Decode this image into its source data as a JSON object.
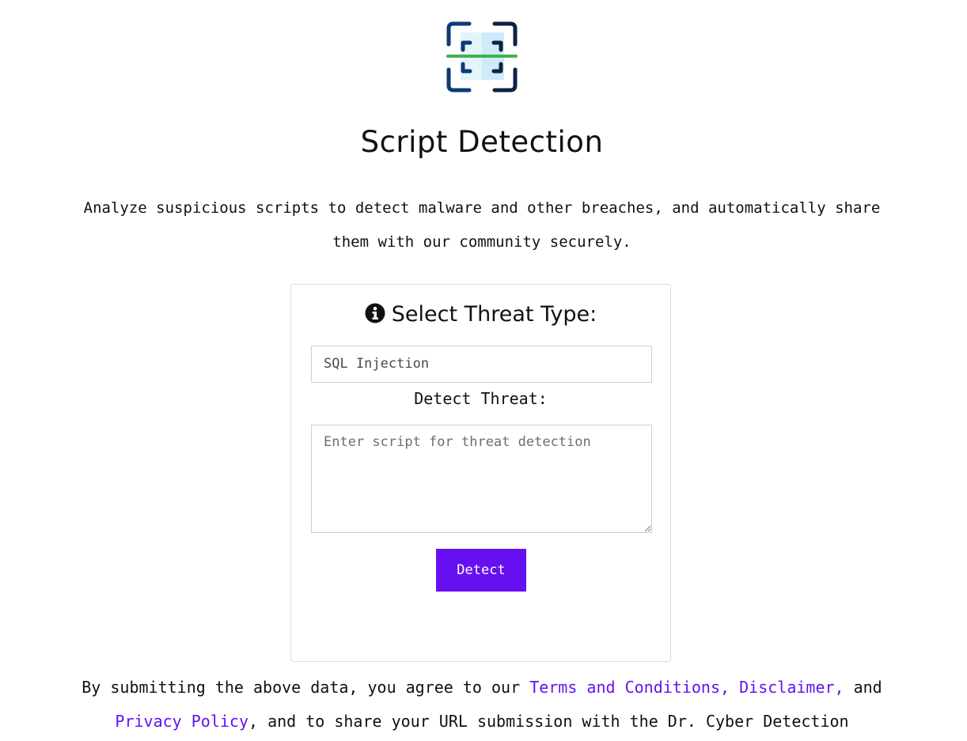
{
  "logo": {
    "icon": "scan-frame-icon"
  },
  "header": {
    "title": "Script Detection",
    "description": "Analyze suspicious scripts to detect malware and other breaches, and automatically share them with our community securely."
  },
  "form": {
    "heading": "Select Threat Type:",
    "heading_icon": "info-circle-icon",
    "threat_type_value": "SQL Injection",
    "detect_label": "Detect Threat:",
    "script_placeholder": "Enter script for threat detection",
    "detect_button_label": "Detect",
    "button_color": "#6610f2"
  },
  "footer": {
    "text_before": "By submitting the above data, you agree to our ",
    "terms_link": "Terms and Conditions,",
    "disclaimer_link": "Disclaimer,",
    "text_and": " and",
    "privacy_link": "Privacy Policy",
    "text_after": ", and to share your URL submission with the Dr. Cyber Detection Community.",
    "link_color": "#6610f2"
  }
}
